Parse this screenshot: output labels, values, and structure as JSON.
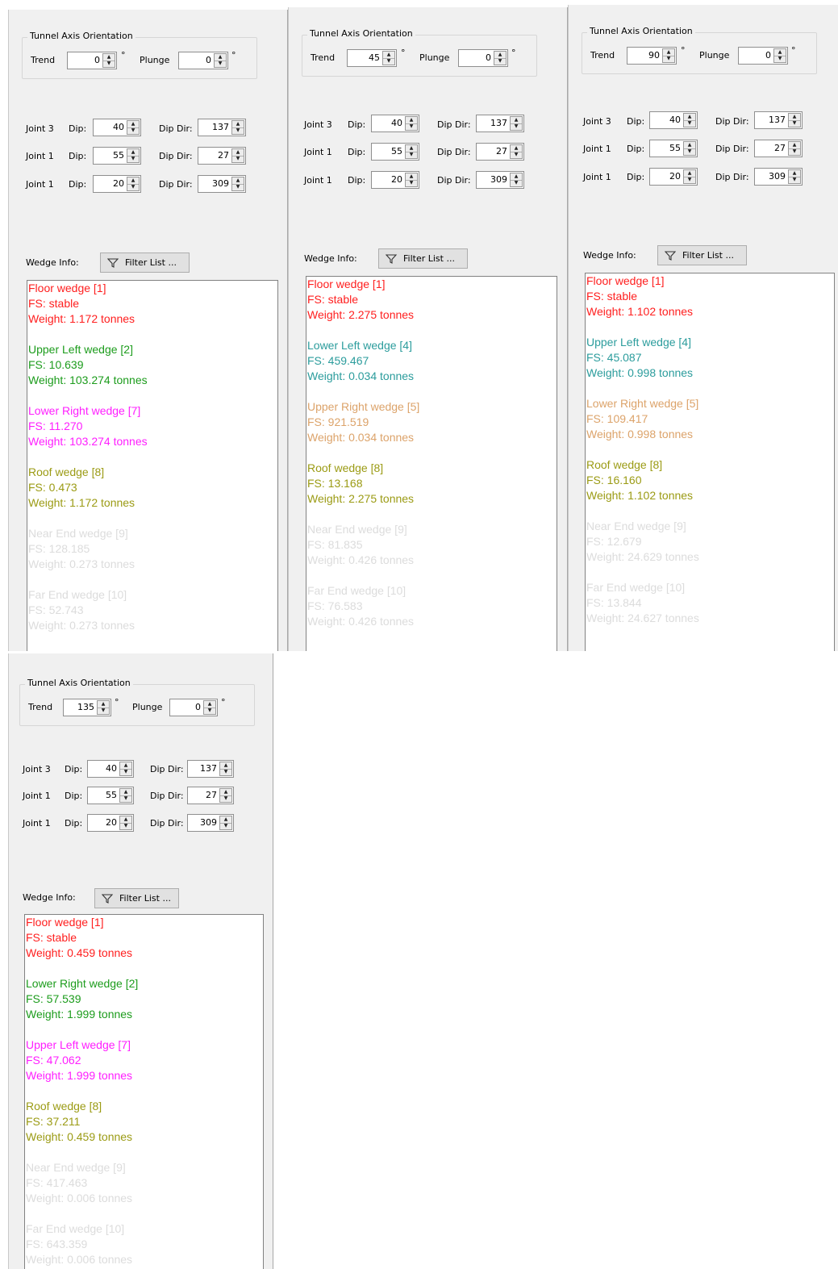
{
  "labels": {
    "group_title": "Tunnel Axis Orientation",
    "trend": "Trend",
    "plunge": "Plunge",
    "degree": "°",
    "dip": "Dip:",
    "dip_dir": "Dip Dir:",
    "wedge_info": "Wedge Info:",
    "filter_list": "Filter List ..."
  },
  "colors": {
    "red": "#ff1e1e",
    "green": "#1c9c1c",
    "magenta": "#ff1eff",
    "olive": "#9b9b14",
    "teal": "#2b9c9c",
    "tan": "#dca36a",
    "faded": "#dcdcdc"
  },
  "panels": [
    {
      "trend": "0",
      "plunge": "0",
      "joints": [
        {
          "name": "Joint 3",
          "dip": "40",
          "dip_dir": "137"
        },
        {
          "name": "Joint 1",
          "dip": "55",
          "dip_dir": "27"
        },
        {
          "name": "Joint 1",
          "dip": "20",
          "dip_dir": "309"
        }
      ],
      "wedges": [
        {
          "title": "Floor wedge [1]",
          "fs": "FS: stable",
          "weight": "Weight: 1.172 tonnes",
          "color": "#ff1e1e"
        },
        {
          "title": "Upper Left wedge [2]",
          "fs": "FS: 10.639",
          "weight": "Weight: 103.274 tonnes",
          "color": "#1c9c1c"
        },
        {
          "title": "Lower Right wedge [7]",
          "fs": "FS: 11.270",
          "weight": "Weight: 103.274 tonnes",
          "color": "#ff1eff"
        },
        {
          "title": "Roof wedge [8]",
          "fs": "FS: 0.473",
          "weight": "Weight: 1.172 tonnes",
          "color": "#9b9b14"
        },
        {
          "title": "Near End wedge [9]",
          "fs": "FS: 128.185",
          "weight": "Weight: 0.273 tonnes",
          "color": "#dcdcdc"
        },
        {
          "title": "Far End wedge [10]",
          "fs": "FS: 52.743",
          "weight": "Weight: 0.273 tonnes",
          "color": "#dcdcdc"
        }
      ]
    },
    {
      "trend": "45",
      "plunge": "0",
      "joints": [
        {
          "name": "Joint 3",
          "dip": "40",
          "dip_dir": "137"
        },
        {
          "name": "Joint 1",
          "dip": "55",
          "dip_dir": "27"
        },
        {
          "name": "Joint 1",
          "dip": "20",
          "dip_dir": "309"
        }
      ],
      "wedges": [
        {
          "title": "Floor wedge [1]",
          "fs": "FS: stable",
          "weight": "Weight: 2.275 tonnes",
          "color": "#ff1e1e"
        },
        {
          "title": "Lower Left wedge [4]",
          "fs": "FS: 459.467",
          "weight": "Weight: 0.034 tonnes",
          "color": "#2b9c9c"
        },
        {
          "title": "Upper Right wedge [5]",
          "fs": "FS: 921.519",
          "weight": "Weight: 0.034 tonnes",
          "color": "#dca36a"
        },
        {
          "title": "Roof wedge [8]",
          "fs": "FS: 13.168",
          "weight": "Weight: 2.275 tonnes",
          "color": "#9b9b14"
        },
        {
          "title": "Near End wedge [9]",
          "fs": "FS: 81.835",
          "weight": "Weight: 0.426 tonnes",
          "color": "#dcdcdc"
        },
        {
          "title": "Far End wedge [10]",
          "fs": "FS: 76.583",
          "weight": "Weight: 0.426 tonnes",
          "color": "#dcdcdc"
        }
      ]
    },
    {
      "trend": "90",
      "plunge": "0",
      "joints": [
        {
          "name": "Joint 3",
          "dip": "40",
          "dip_dir": "137"
        },
        {
          "name": "Joint 1",
          "dip": "55",
          "dip_dir": "27"
        },
        {
          "name": "Joint 1",
          "dip": "20",
          "dip_dir": "309"
        }
      ],
      "wedges": [
        {
          "title": "Floor wedge [1]",
          "fs": "FS: stable",
          "weight": "Weight: 1.102 tonnes",
          "color": "#ff1e1e"
        },
        {
          "title": "Upper Left wedge [4]",
          "fs": "FS: 45.087",
          "weight": "Weight: 0.998 tonnes",
          "color": "#2b9c9c"
        },
        {
          "title": "Lower Right wedge [5]",
          "fs": "FS: 109.417",
          "weight": "Weight: 0.998 tonnes",
          "color": "#dca36a"
        },
        {
          "title": "Roof wedge [8]",
          "fs": "FS: 16.160",
          "weight": "Weight: 1.102 tonnes",
          "color": "#9b9b14"
        },
        {
          "title": "Near End wedge [9]",
          "fs": "FS: 12.679",
          "weight": "Weight: 24.629 tonnes",
          "color": "#dcdcdc"
        },
        {
          "title": "Far End wedge [10]",
          "fs": "FS: 13.844",
          "weight": "Weight: 24.627 tonnes",
          "color": "#dcdcdc"
        }
      ]
    },
    {
      "trend": "135",
      "plunge": "0",
      "joints": [
        {
          "name": "Joint 3",
          "dip": "40",
          "dip_dir": "137"
        },
        {
          "name": "Joint 1",
          "dip": "55",
          "dip_dir": "27"
        },
        {
          "name": "Joint 1",
          "dip": "20",
          "dip_dir": "309"
        }
      ],
      "wedges": [
        {
          "title": "Floor wedge [1]",
          "fs": "FS: stable",
          "weight": "Weight: 0.459 tonnes",
          "color": "#ff1e1e"
        },
        {
          "title": "Lower Right wedge [2]",
          "fs": "FS: 57.539",
          "weight": "Weight: 1.999 tonnes",
          "color": "#1c9c1c"
        },
        {
          "title": "Upper Left wedge [7]",
          "fs": "FS: 47.062",
          "weight": "Weight: 1.999 tonnes",
          "color": "#ff1eff"
        },
        {
          "title": "Roof wedge [8]",
          "fs": "FS: 37.211",
          "weight": "Weight: 0.459 tonnes",
          "color": "#9b9b14"
        },
        {
          "title": "Near End wedge [9]",
          "fs": "FS: 417.463",
          "weight": "Weight: 0.006 tonnes",
          "color": "#dcdcdc"
        },
        {
          "title": "Far End wedge [10]",
          "fs": "FS: 643.359",
          "weight": "Weight: 0.006 tonnes",
          "color": "#dcdcdc"
        }
      ]
    }
  ]
}
